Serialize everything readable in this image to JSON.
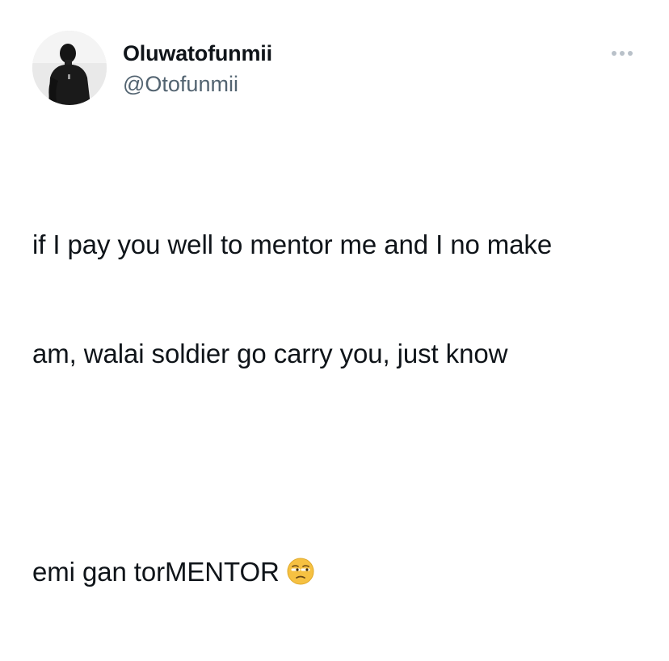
{
  "author": {
    "display_name": "Oluwatofunmii",
    "handle": "@Otofunmii",
    "avatar_icon": "profile-photo"
  },
  "actions": {
    "more_icon": "more-horizontal-icon"
  },
  "tweet": {
    "line1": "if I pay you well to mentor me and I no make",
    "line2": "am, walai soldier go carry you, just know",
    "line3": "emi gan torMENTOR",
    "emoji": "unamused-face-emoji"
  },
  "colors": {
    "text_primary": "#0f1419",
    "text_secondary": "#536471",
    "emoji_face": "#f6c142"
  }
}
